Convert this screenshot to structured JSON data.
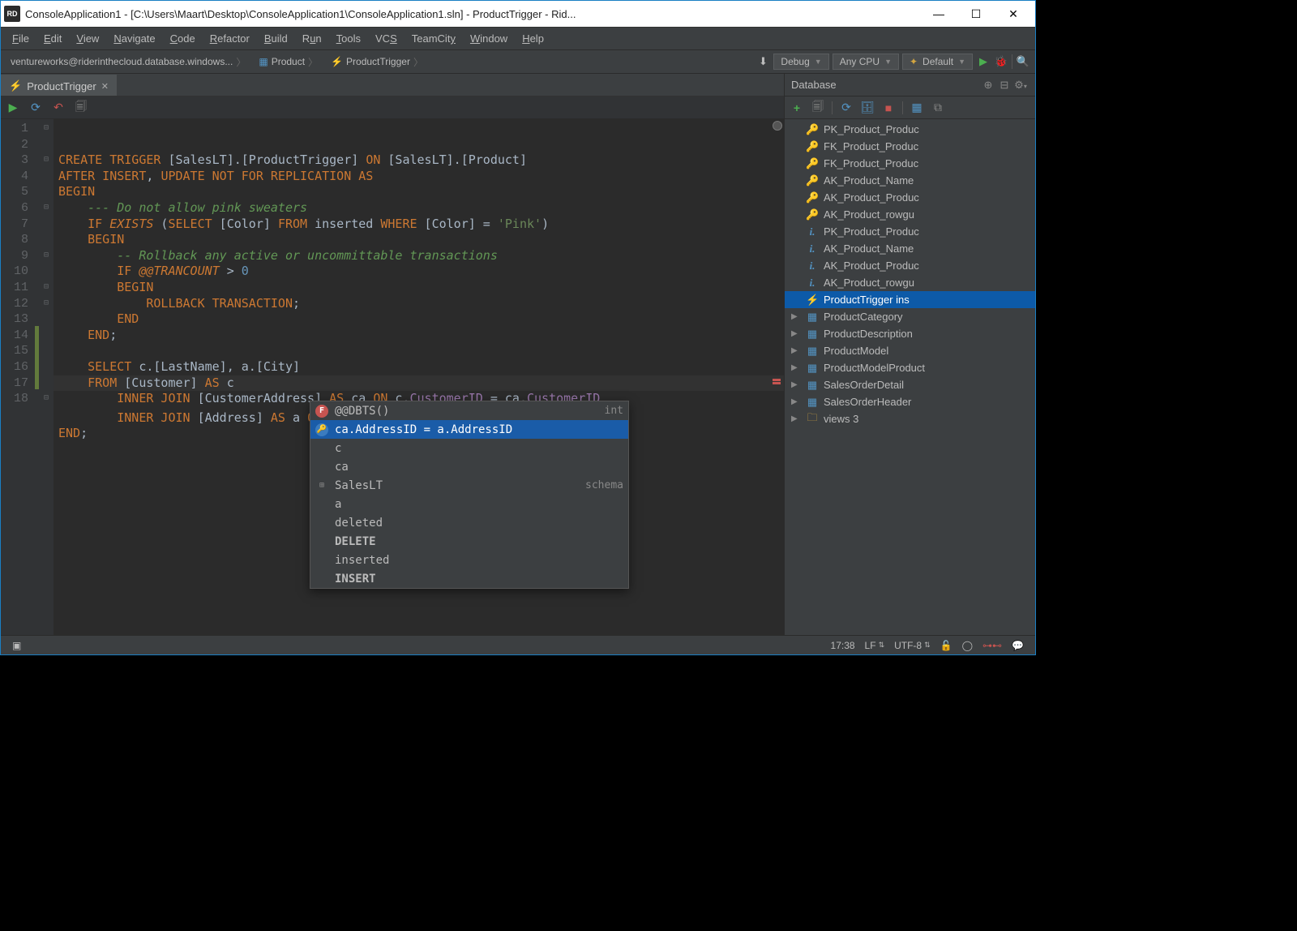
{
  "titlebar": {
    "icon_text": "RD",
    "text": "ConsoleApplication1 - [C:\\Users\\Maart\\Desktop\\ConsoleApplication1\\ConsoleApplication1.sln] - ProductTrigger - Rid..."
  },
  "menubar": [
    "File",
    "Edit",
    "View",
    "Navigate",
    "Code",
    "Refactor",
    "Build",
    "Run",
    "Tools",
    "VCS",
    "TeamCity",
    "Window",
    "Help"
  ],
  "breadcrumb": {
    "db": "ventureworks@riderinthecloud.database.windows...",
    "table": "Product",
    "trigger": "ProductTrigger"
  },
  "run_config": {
    "config": "Debug",
    "platform": "Any CPU",
    "default": "Default"
  },
  "tab": {
    "name": "ProductTrigger"
  },
  "code_lines": [
    "CREATE TRIGGER [SalesLT].[ProductTrigger] ON [SalesLT].[Product]",
    "AFTER INSERT, UPDATE NOT FOR REPLICATION AS",
    "BEGIN",
    "    --- Do not allow pink sweaters",
    "    IF EXISTS (SELECT [Color] FROM inserted WHERE [Color] = 'Pink')",
    "    BEGIN",
    "        -- Rollback any active or uncommittable transactions",
    "        IF @@TRANCOUNT > 0",
    "        BEGIN",
    "            ROLLBACK TRANSACTION;",
    "        END",
    "    END;",
    "",
    "    SELECT c.[LastName], a.[City]",
    "    FROM [Customer] AS c",
    "        INNER JOIN [CustomerAddress] AS ca ON c.CustomerID = ca.CustomerID",
    "        INNER JOIN [Address] AS a ON ",
    "END;"
  ],
  "autocomplete": [
    {
      "icon": "F",
      "label": "@@DBTS()",
      "type": "int"
    },
    {
      "icon": "K",
      "label": "ca.AddressID = a.AddressID",
      "type": "",
      "sel": true
    },
    {
      "icon": "",
      "label": "c",
      "type": ""
    },
    {
      "icon": "",
      "label": "ca",
      "type": ""
    },
    {
      "icon": "S",
      "label": "SalesLT",
      "type": "schema"
    },
    {
      "icon": "",
      "label": "a",
      "type": ""
    },
    {
      "icon": "",
      "label": "deleted",
      "type": ""
    },
    {
      "icon": "",
      "label": "DELETE",
      "type": "",
      "bold": true
    },
    {
      "icon": "",
      "label": "inserted",
      "type": ""
    },
    {
      "icon": "",
      "label": "INSERT",
      "type": "",
      "bold": true
    }
  ],
  "database": {
    "title": "Database",
    "items": [
      {
        "icon": "key-y",
        "label": "PK_Product_Produc"
      },
      {
        "icon": "key-b",
        "label": "FK_Product_Produc"
      },
      {
        "icon": "key-b",
        "label": "FK_Product_Produc"
      },
      {
        "icon": "key-y",
        "label": "AK_Product_Name"
      },
      {
        "icon": "key-y",
        "label": "AK_Product_Produc"
      },
      {
        "icon": "key-y",
        "label": "AK_Product_rowgu"
      },
      {
        "icon": "info",
        "label": "PK_Product_Produc"
      },
      {
        "icon": "info",
        "label": "AK_Product_Name"
      },
      {
        "icon": "info",
        "label": "AK_Product_Produc"
      },
      {
        "icon": "info",
        "label": "AK_Product_rowgu"
      },
      {
        "icon": "bolt",
        "label": "ProductTrigger ins",
        "sel": true
      },
      {
        "icon": "table",
        "label": "ProductCategory",
        "exp": true
      },
      {
        "icon": "table",
        "label": "ProductDescription",
        "exp": true
      },
      {
        "icon": "table",
        "label": "ProductModel",
        "exp": true
      },
      {
        "icon": "table",
        "label": "ProductModelProduct",
        "exp": true
      },
      {
        "icon": "table",
        "label": "SalesOrderDetail",
        "exp": true
      },
      {
        "icon": "table",
        "label": "SalesOrderHeader",
        "exp": true
      },
      {
        "icon": "folder",
        "label": "views 3",
        "exp": true
      }
    ]
  },
  "statusbar": {
    "pos": "17:38",
    "le": "LF",
    "enc": "UTF-8"
  }
}
